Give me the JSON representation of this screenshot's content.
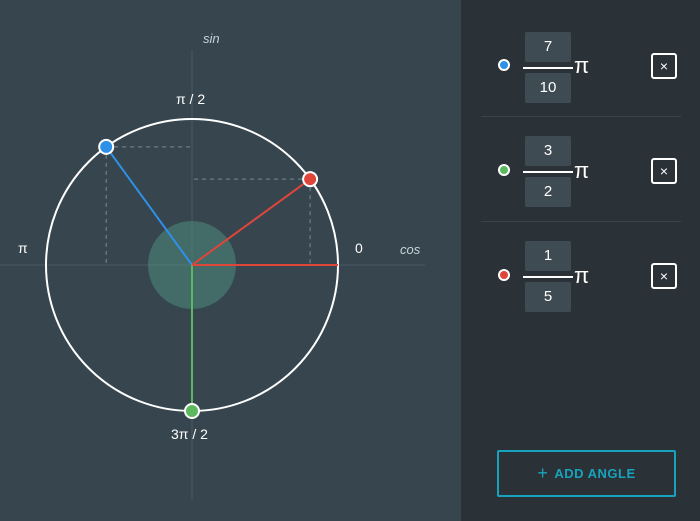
{
  "axes": {
    "x_label": "cos",
    "y_label": "sin"
  },
  "circle_labels": {
    "right": "0",
    "top": "π / 2",
    "left": "π",
    "bottom": "3π / 2"
  },
  "colors": {
    "blue": "#2f90e8",
    "green": "#5cb85c",
    "red": "#e0453a",
    "accent": "#17a3bd",
    "circle": "#ffffff"
  },
  "angles": [
    {
      "numerator": "7",
      "denominator": "10",
      "pi_symbol": "π",
      "color": "#2f90e8",
      "remove_label": "×"
    },
    {
      "numerator": "3",
      "denominator": "2",
      "pi_symbol": "π",
      "color": "#5cb85c",
      "remove_label": "×"
    },
    {
      "numerator": "1",
      "denominator": "5",
      "pi_symbol": "π",
      "color": "#e0453a",
      "remove_label": "×"
    }
  ],
  "add_button": {
    "plus": "+",
    "label": "ADD ANGLE"
  }
}
